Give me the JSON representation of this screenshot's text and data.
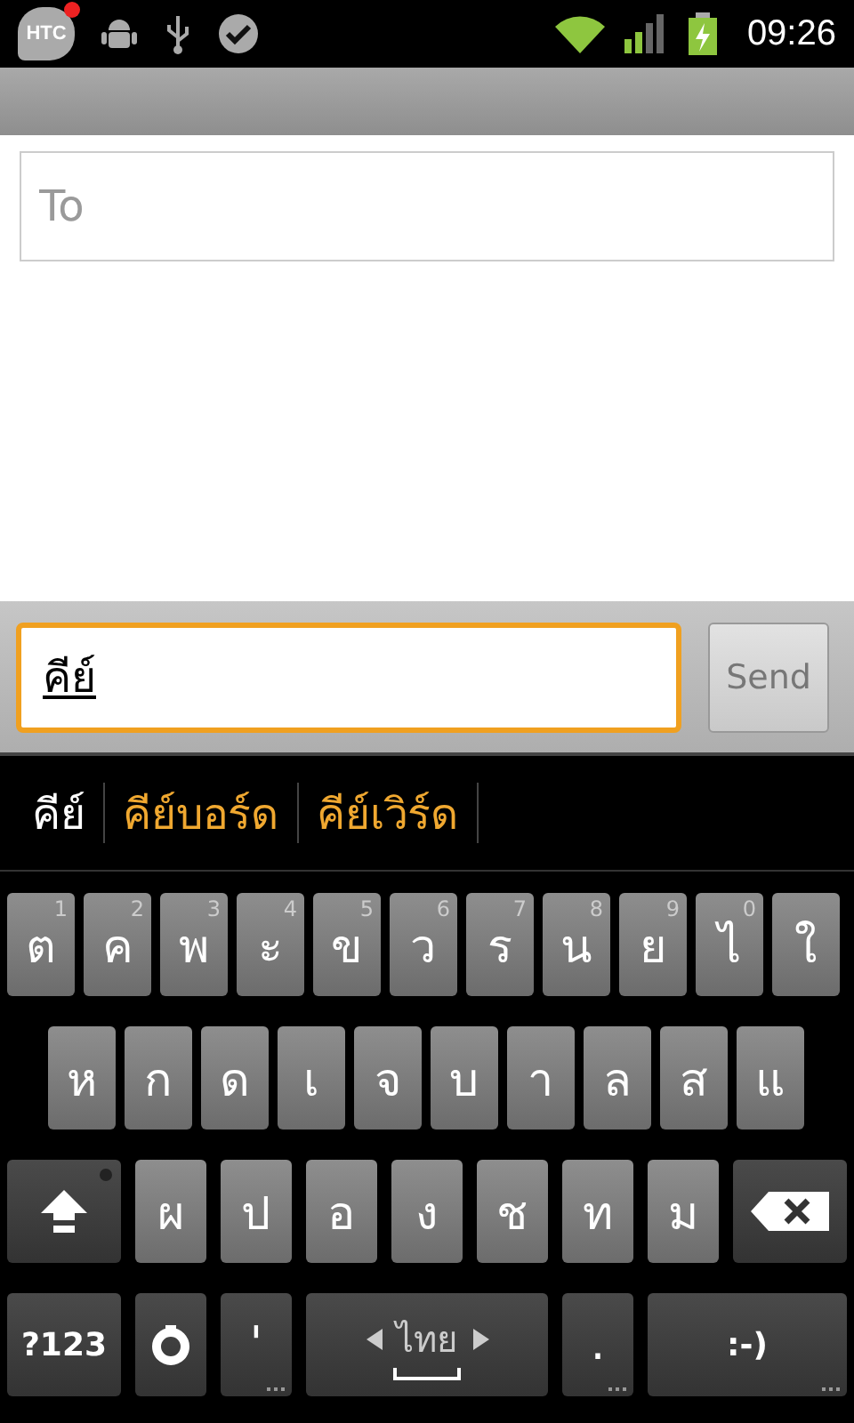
{
  "status_bar": {
    "app_badge": "HTC",
    "time": "09:26"
  },
  "to_field": {
    "placeholder": "To"
  },
  "compose": {
    "value": "คีย์",
    "send_button": "Send"
  },
  "suggestions": [
    {
      "text": "คีย์",
      "selected": true
    },
    {
      "text": "คีย์บอร์ด",
      "selected": false
    },
    {
      "text": "คีย์เวิร์ด",
      "selected": false
    }
  ],
  "keyboard": {
    "rows": [
      {
        "keys": [
          {
            "kind": "char",
            "label": "ต",
            "hint": "1"
          },
          {
            "kind": "char",
            "label": "ค",
            "hint": "2"
          },
          {
            "kind": "char",
            "label": "พ",
            "hint": "3"
          },
          {
            "kind": "char",
            "label": "ะ",
            "hint": "4"
          },
          {
            "kind": "char",
            "label": "ข",
            "hint": "5"
          },
          {
            "kind": "char",
            "label": "ว",
            "hint": "6"
          },
          {
            "kind": "char",
            "label": "ร",
            "hint": "7"
          },
          {
            "kind": "char",
            "label": "น",
            "hint": "8"
          },
          {
            "kind": "char",
            "label": "ย",
            "hint": "9"
          },
          {
            "kind": "char",
            "label": "ไ",
            "hint": "0"
          },
          {
            "kind": "char",
            "label": "ใ"
          }
        ]
      },
      {
        "keys": [
          {
            "kind": "char",
            "label": "ห"
          },
          {
            "kind": "char",
            "label": "ก"
          },
          {
            "kind": "char",
            "label": "ด"
          },
          {
            "kind": "char",
            "label": "เ"
          },
          {
            "kind": "char",
            "label": "จ"
          },
          {
            "kind": "char",
            "label": "บ"
          },
          {
            "kind": "char",
            "label": "า"
          },
          {
            "kind": "char",
            "label": "ล"
          },
          {
            "kind": "char",
            "label": "ส"
          },
          {
            "kind": "char",
            "label": "แ"
          }
        ]
      },
      {
        "keys": [
          {
            "kind": "shift",
            "locked": false
          },
          {
            "kind": "char",
            "label": "ผ"
          },
          {
            "kind": "char",
            "label": "ป"
          },
          {
            "kind": "char",
            "label": "อ"
          },
          {
            "kind": "char",
            "label": "ง"
          },
          {
            "kind": "char",
            "label": "ช"
          },
          {
            "kind": "char",
            "label": "ท"
          },
          {
            "kind": "char",
            "label": "ม"
          },
          {
            "kind": "backspace"
          }
        ]
      },
      {
        "keys": [
          {
            "kind": "symbols",
            "label": "?123",
            "more": false
          },
          {
            "kind": "settings",
            "more": false
          },
          {
            "kind": "punct",
            "label": "'",
            "more": true
          },
          {
            "kind": "space",
            "label": "ไทย",
            "more": false
          },
          {
            "kind": "punct",
            "label": ".",
            "more": true
          },
          {
            "kind": "smiley",
            "label": ":-)",
            "more": true
          }
        ]
      }
    ]
  }
}
